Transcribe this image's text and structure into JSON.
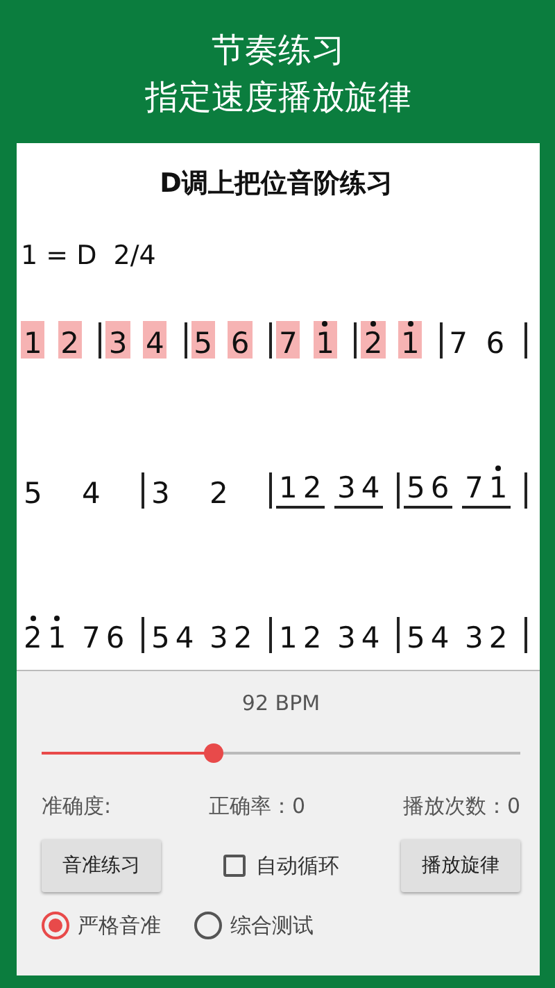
{
  "header": {
    "title": "节奏练习",
    "subtitle": "指定速度播放旋律"
  },
  "score": {
    "title": "D调上把位音阶练习",
    "key": "1 = D  2/4",
    "lines": [
      {
        "measures": [
          {
            "groups": [
              {
                "underline": false,
                "notes": [
                  {
                    "digit": "1",
                    "high": false,
                    "highlighted": true
                  }
                ]
              },
              {
                "underline": false,
                "notes": [
                  {
                    "digit": "2",
                    "high": false,
                    "highlighted": true
                  }
                ]
              }
            ]
          },
          {
            "groups": [
              {
                "underline": false,
                "notes": [
                  {
                    "digit": "3",
                    "high": false,
                    "highlighted": true
                  }
                ]
              },
              {
                "underline": false,
                "notes": [
                  {
                    "digit": "4",
                    "high": false,
                    "highlighted": true
                  }
                ]
              }
            ]
          },
          {
            "groups": [
              {
                "underline": false,
                "notes": [
                  {
                    "digit": "5",
                    "high": false,
                    "highlighted": true
                  }
                ]
              },
              {
                "underline": false,
                "notes": [
                  {
                    "digit": "6",
                    "high": false,
                    "highlighted": true
                  }
                ]
              }
            ]
          },
          {
            "groups": [
              {
                "underline": false,
                "notes": [
                  {
                    "digit": "7",
                    "high": false,
                    "highlighted": true
                  }
                ]
              },
              {
                "underline": false,
                "notes": [
                  {
                    "digit": "1",
                    "high": true,
                    "highlighted": true
                  }
                ]
              }
            ]
          },
          {
            "groups": [
              {
                "underline": false,
                "notes": [
                  {
                    "digit": "2",
                    "high": true,
                    "highlighted": true
                  }
                ]
              },
              {
                "underline": false,
                "notes": [
                  {
                    "digit": "1",
                    "high": true,
                    "highlighted": true
                  }
                ]
              }
            ]
          },
          {
            "groups": [
              {
                "underline": false,
                "notes": [
                  {
                    "digit": "7",
                    "high": false,
                    "highlighted": false
                  }
                ]
              },
              {
                "underline": false,
                "notes": [
                  {
                    "digit": "6",
                    "high": false,
                    "highlighted": false
                  }
                ]
              }
            ]
          }
        ]
      },
      {
        "measures": [
          {
            "groups": [
              {
                "underline": false,
                "notes": [
                  {
                    "digit": "5",
                    "high": false,
                    "highlighted": false
                  }
                ]
              },
              {
                "underline": false,
                "notes": [
                  {
                    "digit": "4",
                    "high": false,
                    "highlighted": false
                  }
                ]
              }
            ]
          },
          {
            "groups": [
              {
                "underline": false,
                "notes": [
                  {
                    "digit": "3",
                    "high": false,
                    "highlighted": false
                  }
                ]
              },
              {
                "underline": false,
                "notes": [
                  {
                    "digit": "2",
                    "high": false,
                    "highlighted": false
                  }
                ]
              }
            ]
          },
          {
            "groups": [
              {
                "underline": true,
                "notes": [
                  {
                    "digit": "1",
                    "high": false,
                    "highlighted": false
                  },
                  {
                    "digit": "2",
                    "high": false,
                    "highlighted": false
                  }
                ]
              },
              {
                "underline": true,
                "notes": [
                  {
                    "digit": "3",
                    "high": false,
                    "highlighted": false
                  },
                  {
                    "digit": "4",
                    "high": false,
                    "highlighted": false
                  }
                ]
              }
            ]
          },
          {
            "groups": [
              {
                "underline": true,
                "notes": [
                  {
                    "digit": "5",
                    "high": false,
                    "highlighted": false
                  },
                  {
                    "digit": "6",
                    "high": false,
                    "highlighted": false
                  }
                ]
              },
              {
                "underline": true,
                "notes": [
                  {
                    "digit": "7",
                    "high": false,
                    "highlighted": false
                  },
                  {
                    "digit": "1",
                    "high": true,
                    "highlighted": false
                  }
                ]
              }
            ]
          }
        ]
      },
      {
        "measures": [
          {
            "groups": [
              {
                "underline": false,
                "notes": [
                  {
                    "digit": "2",
                    "high": true,
                    "highlighted": false
                  },
                  {
                    "digit": "1",
                    "high": true,
                    "highlighted": false
                  }
                ]
              },
              {
                "underline": false,
                "notes": [
                  {
                    "digit": "7",
                    "high": false,
                    "highlighted": false
                  },
                  {
                    "digit": "6",
                    "high": false,
                    "highlighted": false
                  }
                ]
              }
            ]
          },
          {
            "groups": [
              {
                "underline": false,
                "notes": [
                  {
                    "digit": "5",
                    "high": false,
                    "highlighted": false
                  },
                  {
                    "digit": "4",
                    "high": false,
                    "highlighted": false
                  }
                ]
              },
              {
                "underline": false,
                "notes": [
                  {
                    "digit": "3",
                    "high": false,
                    "highlighted": false
                  },
                  {
                    "digit": "2",
                    "high": false,
                    "highlighted": false
                  }
                ]
              }
            ]
          },
          {
            "groups": [
              {
                "underline": false,
                "notes": [
                  {
                    "digit": "1",
                    "high": false,
                    "highlighted": false
                  },
                  {
                    "digit": "2",
                    "high": false,
                    "highlighted": false
                  }
                ]
              },
              {
                "underline": false,
                "notes": [
                  {
                    "digit": "3",
                    "high": false,
                    "highlighted": false
                  },
                  {
                    "digit": "4",
                    "high": false,
                    "highlighted": false
                  }
                ]
              }
            ]
          },
          {
            "groups": [
              {
                "underline": false,
                "notes": [
                  {
                    "digit": "5",
                    "high": false,
                    "highlighted": false
                  },
                  {
                    "digit": "4",
                    "high": false,
                    "highlighted": false
                  }
                ]
              },
              {
                "underline": false,
                "notes": [
                  {
                    "digit": "3",
                    "high": false,
                    "highlighted": false
                  },
                  {
                    "digit": "2",
                    "high": false,
                    "highlighted": false
                  }
                ]
              }
            ]
          }
        ]
      }
    ]
  },
  "tempo": {
    "reading": "92 BPM",
    "level": 0.36
  },
  "stats": [
    {
      "label": "准确度:"
    },
    {
      "label": "正确率：0"
    },
    {
      "label": "播放次数：0"
    }
  ],
  "buttons": [
    {
      "label": "音准练习"
    },
    {
      "label": "播放旋律"
    }
  ],
  "auto_loop": {
    "label": "自动循环",
    "checked": false
  },
  "modes": [
    {
      "label": "严格音准",
      "selected": true
    },
    {
      "label": "综合测试",
      "selected": false
    }
  ]
}
